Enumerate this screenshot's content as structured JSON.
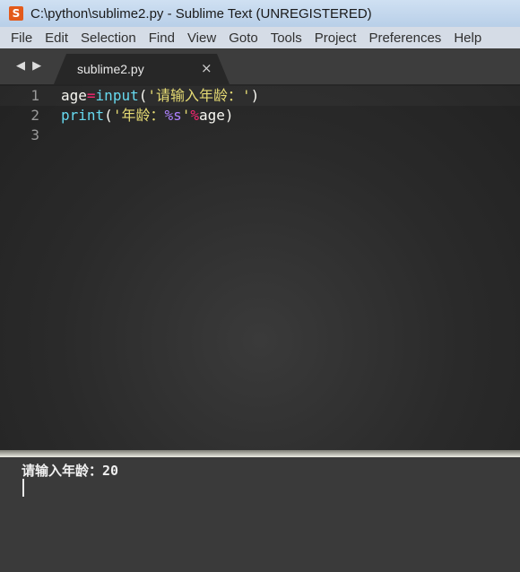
{
  "window": {
    "title": "C:\\python\\sublime2.py - Sublime Text (UNREGISTERED)",
    "icon": "sublime-icon"
  },
  "menu": [
    "File",
    "Edit",
    "Selection",
    "Find",
    "View",
    "Goto",
    "Tools",
    "Project",
    "Preferences",
    "Help"
  ],
  "tabs": {
    "nav": "◀ ▶",
    "active": {
      "label": "sublime2.py",
      "close": "×"
    }
  },
  "editor": {
    "lines": [
      {
        "number": "1",
        "tokens": [
          {
            "t": "age",
            "c": "ident"
          },
          {
            "t": "=",
            "c": "op"
          },
          {
            "t": "input",
            "c": "func"
          },
          {
            "t": "(",
            "c": "paren"
          },
          {
            "t": "'请输入年龄：'",
            "c": "str"
          },
          {
            "t": ")",
            "c": "paren"
          }
        ]
      },
      {
        "number": "2",
        "tokens": [
          {
            "t": "print",
            "c": "func"
          },
          {
            "t": "(",
            "c": "paren"
          },
          {
            "t": "'年龄：",
            "c": "str"
          },
          {
            "t": "%s",
            "c": "fmt"
          },
          {
            "t": "'",
            "c": "str"
          },
          {
            "t": "%",
            "c": "op"
          },
          {
            "t": "age",
            "c": "ident"
          },
          {
            "t": ")",
            "c": "paren"
          }
        ]
      },
      {
        "number": "3",
        "tokens": []
      }
    ]
  },
  "output": {
    "text": "请输入年龄：20"
  },
  "colors": {
    "keyword_op": "#f92672",
    "function": "#66d9ef",
    "string": "#e6db74",
    "format": "#ae81ff"
  }
}
